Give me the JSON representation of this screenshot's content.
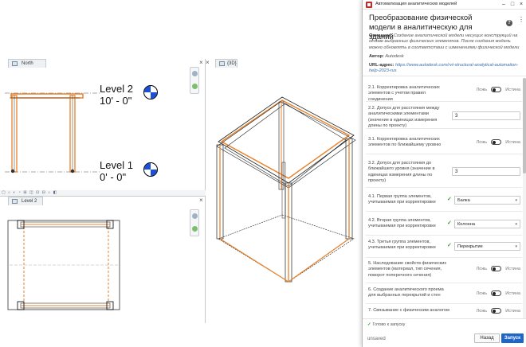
{
  "revit": {
    "north_tab": "North",
    "view3d_tab": "{3D}",
    "level2_tab": "Level 2",
    "close_glyph": "×",
    "levels": [
      {
        "name": "Level 2",
        "elevation": "10' - 0\""
      },
      {
        "name": "Level 1",
        "elevation": "0' - 0\""
      }
    ],
    "accent_orange": "#e8822a",
    "level_marker_blue": "#1a4fd6"
  },
  "dialog": {
    "window_title": "Автоматизация аналитических моделей",
    "minimize": "–",
    "maximize": "□",
    "close": "×",
    "title": "Преобразование физической модели в аналитическую для зданий",
    "description_label": "Описание:",
    "description_text": "Создание аналитической модели несущих конструкций на основе выбранных физических элементов. После создания модель можно обновлять в соответствии с изменениями физической модели",
    "author_label": "Автор:",
    "author_value": "Autodesk",
    "url_label": "URL-адрес:",
    "url_value": "https://www.autodesk.com/rvt-structural-analytical-automation-help-2023-rus",
    "help_glyph": "?",
    "more_glyph": "⋮",
    "settings": {
      "s21": {
        "label": "2.1. Корректировка аналитических элементов с учетом правил соединения",
        "false_label": "Ложь",
        "true_label": "Истина"
      },
      "s22": {
        "label": "2.2. Допуск для расстояния между аналитическими элементами (значение в единицах измерения длины по проекту)",
        "value": "3"
      },
      "s31": {
        "label": "3.1. Корректировка аналитических элементов по ближайшему уровню",
        "false_label": "Ложь",
        "true_label": "Истина"
      },
      "s32": {
        "label": "3.2. Допуск для расстояния до ближайшего уровня (значение в единицах измерения длины по проекту)",
        "value": "3"
      },
      "s41": {
        "label": "4.1. Первая группа элементов, учитываемая при корректировке",
        "value": "Балка"
      },
      "s42": {
        "label": "4.2. Вторая группа элементов, учитываемая при корректировке",
        "value": "Колонна"
      },
      "s43": {
        "label": "4.3. Третья группа элементов, учитываемая при корректировке",
        "value": "Перекрытие"
      },
      "s5": {
        "label": "5. Наследование свойств физических элементов (материал, тип сечения, поворот поперечного сечения)",
        "false_label": "Ложь",
        "true_label": "Истина"
      },
      "s6": {
        "label": "6. Создание аналитического проема для выбранных перекрытий и стен",
        "false_label": "Ложь",
        "true_label": "Истина"
      },
      "s7": {
        "label": "7. Связывание с физическим аналогом",
        "false_label": "Ложь",
        "true_label": "Истина"
      }
    },
    "check_glyph": "✓",
    "caret_glyph": "▾",
    "status": "Готово к запуску",
    "status_glyph": "✓",
    "unsaved": "unsaved",
    "back_button": "Назад",
    "run_button": "Запуск"
  }
}
